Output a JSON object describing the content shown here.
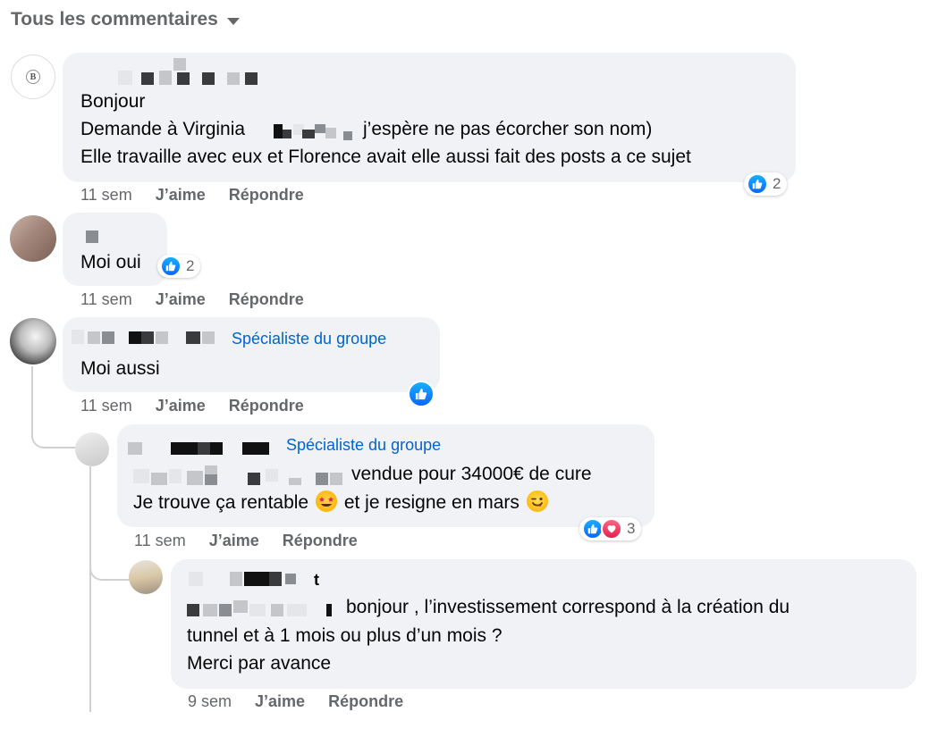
{
  "header": {
    "label": "Tous les commentaires"
  },
  "colors": {
    "accent": "#0866ff",
    "badge": "#0064d1",
    "bubble": "#f0f2f5",
    "meta": "#65676b",
    "love": "#f33e58"
  },
  "comments": [
    {
      "lines": [
        "Bonjour",
        "Demande à Virginia",
        "j’espère ne pas écorcher son nom)",
        "Elle travaille avec eux et Florence avait elle aussi fait des posts a ce sujet"
      ],
      "time": "11 sem",
      "like": "J’aime",
      "reply": "Répondre",
      "reactions": {
        "types": [
          "like-icon"
        ],
        "count": "2"
      }
    },
    {
      "lines": [
        "Moi oui"
      ],
      "time": "11 sem",
      "like": "J’aime",
      "reply": "Répondre",
      "reactions": {
        "types": [
          "like-icon"
        ],
        "count": "2"
      }
    },
    {
      "badge": "Spécialiste du groupe",
      "lines": [
        "Moi aussi"
      ],
      "time": "11 sem",
      "like": "J’aime",
      "reply": "Répondre",
      "reactions": {
        "types": [
          "like-icon"
        ],
        "count": ""
      }
    },
    {
      "badge": "Spécialiste du groupe",
      "lines": [
        "vendue pour 34000€ de cure",
        "Je trouve ça rentable",
        "et je resigne en mars"
      ],
      "emojis": [
        "star-struck-emoji",
        "wink-emoji"
      ],
      "time": "11 sem",
      "like": "J’aime",
      "reply": "Répondre",
      "reactions": {
        "types": [
          "like-icon",
          "love-icon"
        ],
        "count": "3"
      }
    },
    {
      "name_tail": "t",
      "lines": [
        "bonjour , l’investissement correspond à la création du",
        "tunnel et à 1 mois ou plus d’un mois ?",
        "Merci par avance"
      ],
      "time": "9 sem",
      "like": "J’aime",
      "reply": "Répondre"
    }
  ]
}
